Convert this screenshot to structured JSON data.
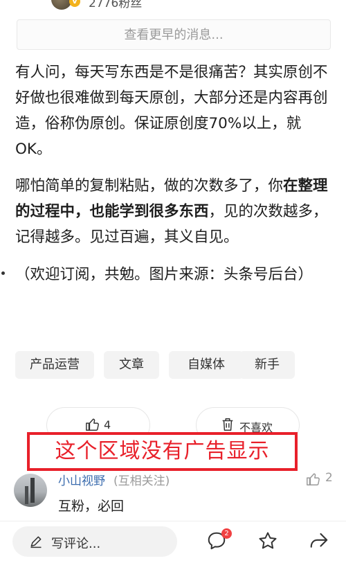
{
  "header": {
    "fans_label": "2776粉丝",
    "verified_mark": "v"
  },
  "earlier_messages": "查看更早的消息...",
  "article": {
    "p1": "有人问，每天写东西是不是很痛苦？其实原创不好做也很难做到每天原创，大部分还是内容再创造，俗称伪原创。保证原创度70%以上，就OK。",
    "p2_a": "哪怕简单的复制粘贴，做的次数多了，你",
    "p2_bold": "在整理的过程中，也能学到很多东西",
    "p2_b": "，见的次数越多，记得越多。见过百遍，其义自见。",
    "p3": "（欢迎订阅，共勉。图片来源：头条号后台）"
  },
  "tags": [
    "产品运营",
    "文章",
    "自媒体",
    "新手"
  ],
  "actions": {
    "like_count": "4",
    "dislike_label": "不喜欢"
  },
  "ad_notice": "这个区域没有广告显示",
  "comment": {
    "name": "小山视野",
    "relation": "(互相关注)",
    "like_count": "2",
    "text": "互粉，必回"
  },
  "bottom_bar": {
    "write_placeholder": "写评论...",
    "comment_badge": "2"
  },
  "icons": [
    "thumbs-up-icon",
    "trash-icon",
    "pen-icon",
    "comment-icon",
    "star-icon",
    "share-icon"
  ],
  "colors": {
    "ad_red": "#e8202a",
    "link_blue": "#3b6cae",
    "badge_red": "#f04142"
  }
}
